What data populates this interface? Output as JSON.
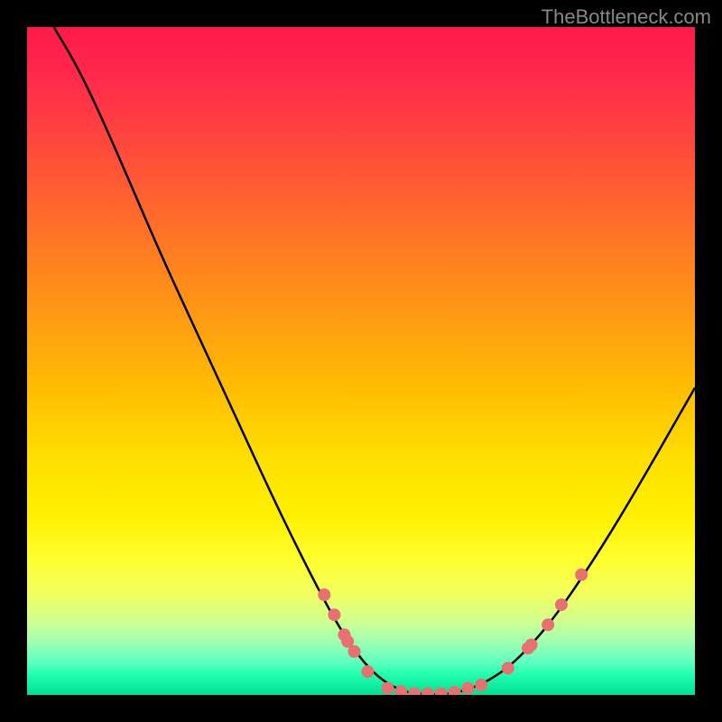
{
  "attribution": "TheBottleneck.com",
  "chart_data": {
    "type": "line",
    "title": "",
    "xlabel": "",
    "ylabel": "",
    "xlim": [
      0,
      100
    ],
    "ylim": [
      0,
      100
    ],
    "curve": [
      {
        "x": 4,
        "y": 100
      },
      {
        "x": 7,
        "y": 95
      },
      {
        "x": 10,
        "y": 89
      },
      {
        "x": 14,
        "y": 80
      },
      {
        "x": 20,
        "y": 66
      },
      {
        "x": 26,
        "y": 53
      },
      {
        "x": 32,
        "y": 40
      },
      {
        "x": 38,
        "y": 27
      },
      {
        "x": 44,
        "y": 15
      },
      {
        "x": 48,
        "y": 8
      },
      {
        "x": 52,
        "y": 3
      },
      {
        "x": 56,
        "y": 0.5
      },
      {
        "x": 60,
        "y": 0
      },
      {
        "x": 64,
        "y": 0.2
      },
      {
        "x": 68,
        "y": 1.5
      },
      {
        "x": 72,
        "y": 4
      },
      {
        "x": 76,
        "y": 8
      },
      {
        "x": 80,
        "y": 13
      },
      {
        "x": 86,
        "y": 22
      },
      {
        "x": 92,
        "y": 32
      },
      {
        "x": 100,
        "y": 46
      }
    ],
    "markers": [
      {
        "x": 44.5,
        "y": 15
      },
      {
        "x": 46,
        "y": 12
      },
      {
        "x": 47.5,
        "y": 9
      },
      {
        "x": 48,
        "y": 8
      },
      {
        "x": 49,
        "y": 6.5
      },
      {
        "x": 51,
        "y": 3.5
      },
      {
        "x": 54,
        "y": 1
      },
      {
        "x": 56,
        "y": 0.5
      },
      {
        "x": 58,
        "y": 0.2
      },
      {
        "x": 60,
        "y": 0.2
      },
      {
        "x": 62,
        "y": 0.2
      },
      {
        "x": 64,
        "y": 0.4
      },
      {
        "x": 66,
        "y": 1
      },
      {
        "x": 68,
        "y": 1.5
      },
      {
        "x": 72,
        "y": 4
      },
      {
        "x": 75,
        "y": 7
      },
      {
        "x": 75.5,
        "y": 7.5
      },
      {
        "x": 78,
        "y": 10.5
      },
      {
        "x": 80,
        "y": 13.5
      },
      {
        "x": 83,
        "y": 18
      }
    ],
    "gradient_stops": [
      {
        "pos": 0,
        "color": "#ff1a4a"
      },
      {
        "pos": 50,
        "color": "#ffc000"
      },
      {
        "pos": 80,
        "color": "#ffff30"
      },
      {
        "pos": 100,
        "color": "#00e090"
      }
    ]
  }
}
